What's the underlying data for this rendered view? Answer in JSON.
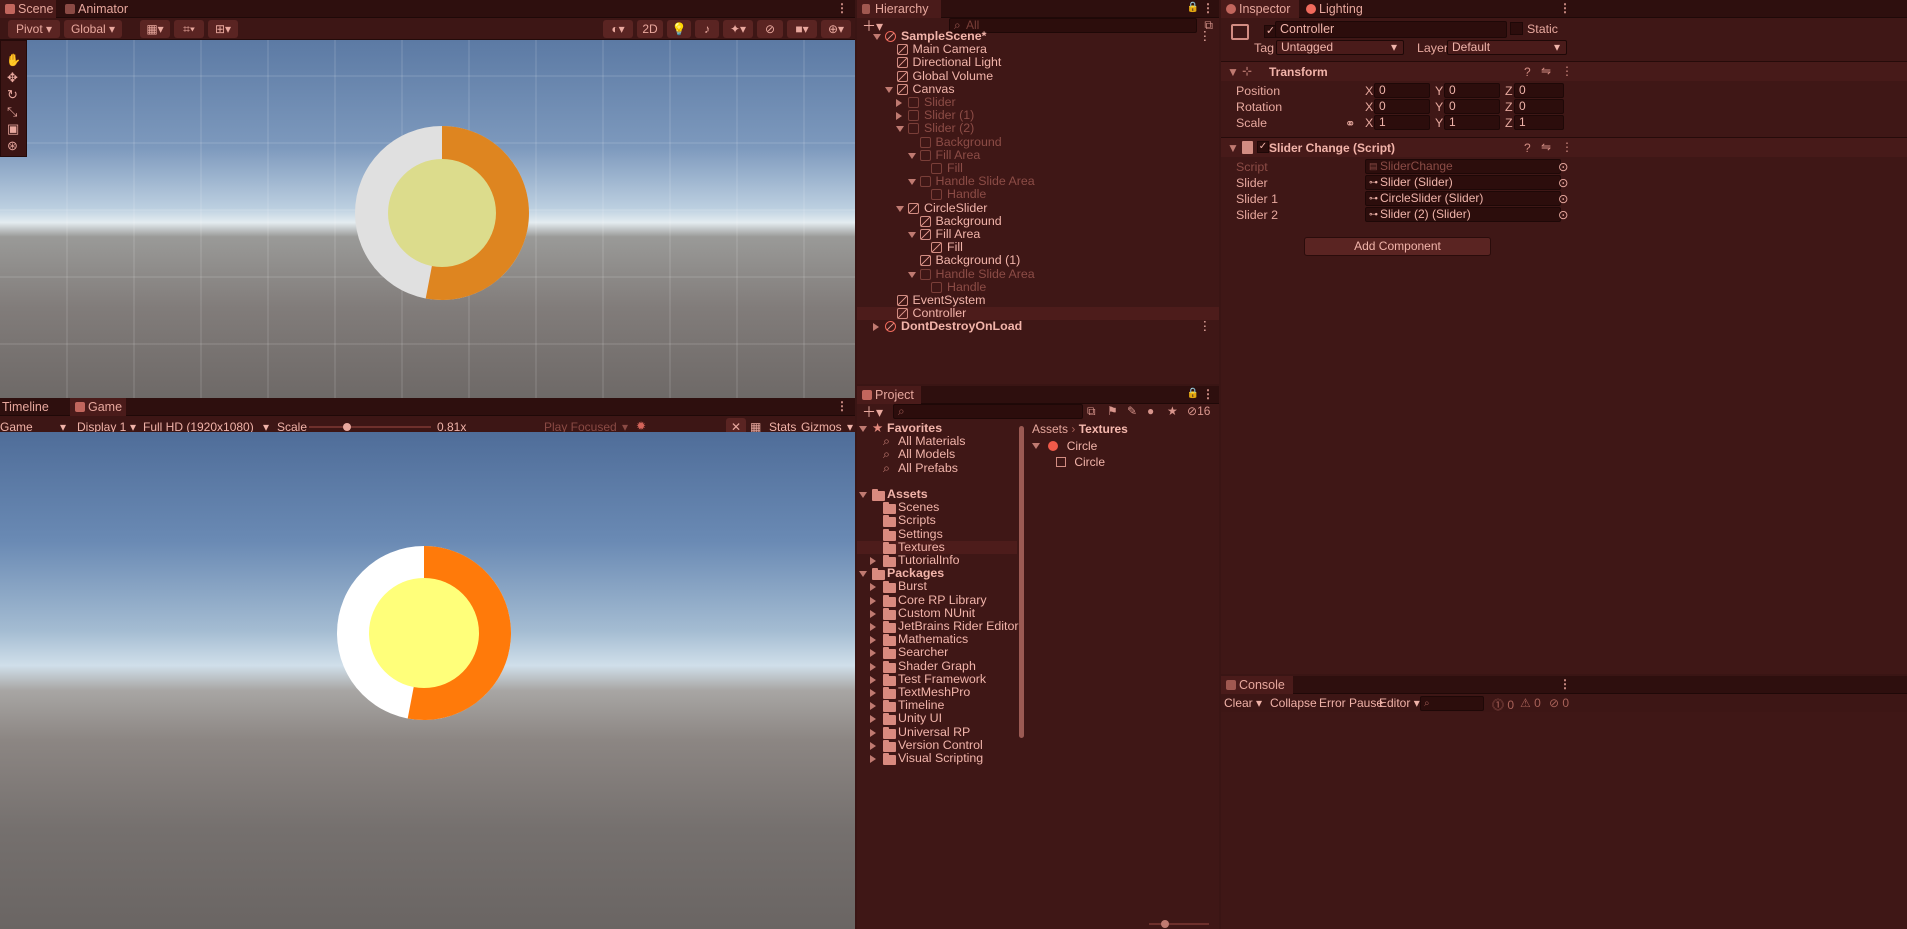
{
  "scene_panel": {
    "tabs": [
      "Scene",
      "Animator"
    ],
    "toolbar": {
      "pivot": "Pivot",
      "global": "Global",
      "mode_2d": "2D"
    }
  },
  "game_panel": {
    "tabs": [
      "Timeline",
      "Game"
    ],
    "toolbar": {
      "view": "Game",
      "display": "Display 1",
      "resolution": "Full HD (1920x1080)",
      "scale_label": "Scale",
      "scale_value": "0.81x",
      "play_focused": "Play Focused",
      "stats": "Stats",
      "gizmos": "Gizmos"
    },
    "scale_slider_fraction": 0.3
  },
  "circle_slider": {
    "fill_fraction": 0.53,
    "ring_color": "#ff7a0a",
    "track_color": "#ffffff",
    "center_color": "#ffff7a"
  },
  "hierarchy": {
    "tab": "Hierarchy",
    "search_placeholder": "All",
    "items": [
      {
        "label": "SampleScene*",
        "depth": 0,
        "kind": "scene",
        "expand": "open",
        "dim": false
      },
      {
        "label": "Main Camera",
        "depth": 1,
        "kind": "obj",
        "expand": "",
        "dim": false
      },
      {
        "label": "Directional Light",
        "depth": 1,
        "kind": "obj",
        "expand": "",
        "dim": false
      },
      {
        "label": "Global Volume",
        "depth": 1,
        "kind": "obj",
        "expand": "",
        "dim": false
      },
      {
        "label": "Canvas",
        "depth": 1,
        "kind": "obj",
        "expand": "open",
        "dim": false
      },
      {
        "label": "Slider",
        "depth": 2,
        "kind": "obj",
        "expand": "closed",
        "dim": true
      },
      {
        "label": "Slider (1)",
        "depth": 2,
        "kind": "obj",
        "expand": "closed",
        "dim": true
      },
      {
        "label": "Slider (2)",
        "depth": 2,
        "kind": "obj",
        "expand": "open",
        "dim": true
      },
      {
        "label": "Background",
        "depth": 3,
        "kind": "obj",
        "expand": "",
        "dim": true
      },
      {
        "label": "Fill Area",
        "depth": 3,
        "kind": "obj",
        "expand": "open",
        "dim": true
      },
      {
        "label": "Fill",
        "depth": 4,
        "kind": "obj",
        "expand": "",
        "dim": true
      },
      {
        "label": "Handle Slide Area",
        "depth": 3,
        "kind": "obj",
        "expand": "open",
        "dim": true
      },
      {
        "label": "Handle",
        "depth": 4,
        "kind": "obj",
        "expand": "",
        "dim": true
      },
      {
        "label": "CircleSlider",
        "depth": 2,
        "kind": "obj",
        "expand": "open",
        "dim": false
      },
      {
        "label": "Background",
        "depth": 3,
        "kind": "obj",
        "expand": "",
        "dim": false
      },
      {
        "label": "Fill Area",
        "depth": 3,
        "kind": "obj",
        "expand": "open",
        "dim": false
      },
      {
        "label": "Fill",
        "depth": 4,
        "kind": "obj",
        "expand": "",
        "dim": false
      },
      {
        "label": "Background (1)",
        "depth": 3,
        "kind": "obj",
        "expand": "",
        "dim": false
      },
      {
        "label": "Handle Slide Area",
        "depth": 3,
        "kind": "obj",
        "expand": "open",
        "dim": true
      },
      {
        "label": "Handle",
        "depth": 4,
        "kind": "obj",
        "expand": "",
        "dim": true
      },
      {
        "label": "EventSystem",
        "depth": 1,
        "kind": "obj",
        "expand": "",
        "dim": false
      },
      {
        "label": "Controller",
        "depth": 1,
        "kind": "obj",
        "expand": "",
        "dim": false,
        "selected": true
      },
      {
        "label": "DontDestroyOnLoad",
        "depth": 0,
        "kind": "scene",
        "expand": "closed",
        "dim": false
      }
    ]
  },
  "inspector": {
    "tabs": [
      "Inspector",
      "Lighting"
    ],
    "object_name": "Controller",
    "static_label": "Static",
    "tag_label": "Tag",
    "tag_value": "Untagged",
    "layer_label": "Layer",
    "layer_value": "Default",
    "transform": {
      "title": "Transform",
      "rows": [
        {
          "label": "Position",
          "x": "0",
          "y": "0",
          "z": "0"
        },
        {
          "label": "Rotation",
          "x": "0",
          "y": "0",
          "z": "0"
        },
        {
          "label": "Scale",
          "x": "1",
          "y": "1",
          "z": "1"
        }
      ],
      "axis": [
        "X",
        "Y",
        "Z"
      ]
    },
    "script": {
      "title": "Slider Change (Script)",
      "rows": [
        {
          "label": "Script",
          "value": "SliderChange",
          "dim": true
        },
        {
          "label": "Slider",
          "value": "Slider (Slider)",
          "dim": false
        },
        {
          "label": "Slider 1",
          "value": "CircleSlider (Slider)",
          "dim": false
        },
        {
          "label": "Slider 2",
          "value": "Slider (2) (Slider)",
          "dim": false
        }
      ]
    },
    "add_component": "Add Component"
  },
  "project": {
    "tab": "Project",
    "badge_count": "16",
    "favorites": {
      "title": "Favorites",
      "items": [
        "All Materials",
        "All Models",
        "All Prefabs"
      ]
    },
    "assets": {
      "title": "Assets",
      "items": [
        "Scenes",
        "Scripts",
        "Settings",
        "Textures",
        "TutorialInfo"
      ],
      "selected": "Textures"
    },
    "packages": {
      "title": "Packages",
      "items": [
        "Burst",
        "Core RP Library",
        "Custom NUnit",
        "JetBrains Rider Editor",
        "Mathematics",
        "Searcher",
        "Shader Graph",
        "Test Framework",
        "TextMeshPro",
        "Timeline",
        "Unity UI",
        "Universal RP",
        "Version Control",
        "Visual Scripting"
      ]
    },
    "breadcrumb": [
      "Assets",
      "Textures"
    ],
    "files": [
      {
        "label": "Circle",
        "kind": "texture"
      },
      {
        "label": "Circle",
        "kind": "sprite"
      }
    ]
  },
  "console": {
    "tab": "Console",
    "buttons": {
      "clear": "Clear",
      "collapse": "Collapse",
      "error_pause": "Error Pause",
      "editor": "Editor"
    },
    "counts": [
      "0",
      "0",
      "0"
    ]
  }
}
